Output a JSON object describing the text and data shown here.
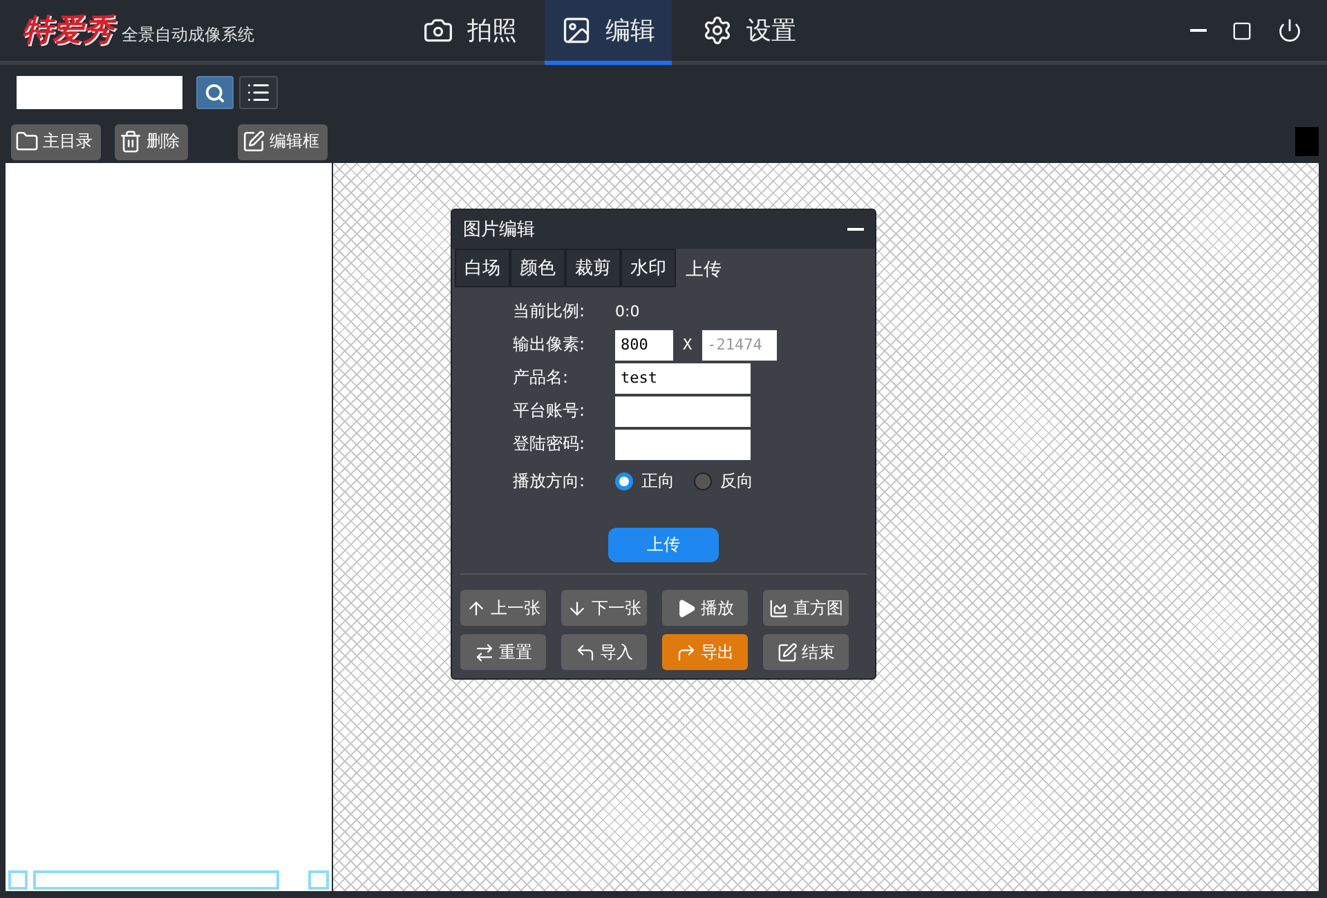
{
  "app": {
    "logo": "特爱秀",
    "subtitle": "全景自动成像系统"
  },
  "nav_tabs": [
    {
      "label": "拍照",
      "kind": "camera",
      "selected": false
    },
    {
      "label": "编辑",
      "kind": "image",
      "selected": true
    },
    {
      "label": "设置",
      "kind": "gear",
      "selected": false
    }
  ],
  "window_controls": [
    {
      "kind": "minimize"
    },
    {
      "kind": "maximize"
    },
    {
      "kind": "power"
    }
  ],
  "file_buttons": [
    {
      "label": "主目录",
      "kind": "folder"
    },
    {
      "label": "删除",
      "kind": "trash"
    },
    {
      "label": "编辑框",
      "kind": "edit"
    }
  ],
  "dialog": {
    "title": "图片编辑",
    "tabs": [
      {
        "label": "白场",
        "selected": false
      },
      {
        "label": "颜色",
        "selected": false
      },
      {
        "label": "裁剪",
        "selected": false
      },
      {
        "label": "水印",
        "selected": false
      },
      {
        "label": "上传",
        "selected": true
      }
    ],
    "rows": [
      {
        "kind": "text",
        "label": "当前比例:",
        "value": "0:0"
      },
      {
        "kind": "size",
        "label": "输出像素:",
        "width": {
          "value": "800",
          "disabled": false
        },
        "separator": "X",
        "height": {
          "value": "-21474",
          "disabled": true
        }
      },
      {
        "kind": "input",
        "label": "产品名:",
        "value": "test"
      },
      {
        "kind": "input",
        "label": "平台账号:"
      },
      {
        "kind": "input",
        "label": "登陆密码:"
      },
      {
        "kind": "radio",
        "label": "播放方向:",
        "options": [
          {
            "label": "正向",
            "selected": true
          },
          {
            "label": "反向",
            "selected": false
          }
        ]
      }
    ],
    "upload_button": "上传",
    "actions": [
      {
        "label": "上一张",
        "kind": "up",
        "highlighted": false
      },
      {
        "label": "下一张",
        "kind": "down",
        "highlighted": false
      },
      {
        "label": "播放",
        "kind": "play",
        "highlighted": false
      },
      {
        "label": "直方图",
        "kind": "chart",
        "highlighted": false
      },
      {
        "label": "重置",
        "kind": "swap",
        "highlighted": false
      },
      {
        "label": "导入",
        "kind": "import",
        "highlighted": false
      },
      {
        "label": "导出",
        "kind": "export",
        "highlighted": true
      },
      {
        "label": "结束",
        "kind": "edit",
        "highlighted": false
      }
    ]
  }
}
